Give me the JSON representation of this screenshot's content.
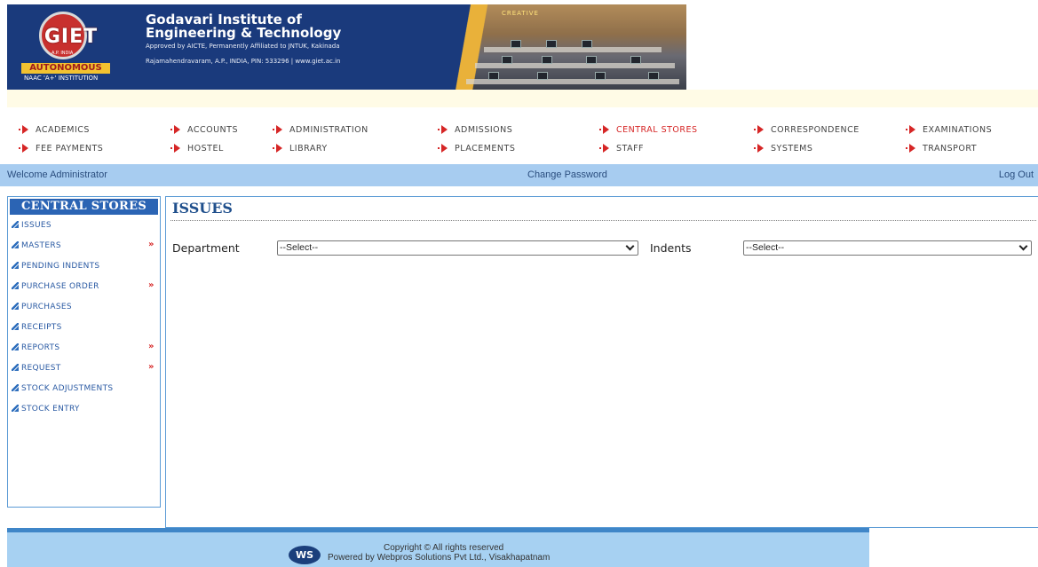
{
  "header": {
    "institute_name_line1": "Godavari Institute of",
    "institute_name_line2": "Engineering & Technology",
    "approval": "Approved by AICTE, Permanently Affiliated to JNTUK, Kakinada",
    "address": "Rajamahendravaram, A.P., INDIA, PIN: 533296 | www.giet.ac.in",
    "logo_letters": "GIET",
    "logo_sub": "A.P. INDIA",
    "logo_autonomous": "AUTONOMOUS",
    "logo_naac": "NAAC 'A+' INSTITUTION",
    "photo_label": "CREATIVE"
  },
  "nav": {
    "row1": [
      "ACADEMICS",
      "ACCOUNTS",
      "ADMINISTRATION",
      "ADMISSIONS",
      "CENTRAL STORES",
      "CORRESPONDENCE",
      "EXAMINATIONS"
    ],
    "row2": [
      "FEE PAYMENTS",
      "HOSTEL",
      "LIBRARY",
      "PLACEMENTS",
      "STAFF",
      "SYSTEMS",
      "TRANSPORT"
    ],
    "active": "CENTRAL STORES"
  },
  "welcome_bar": {
    "welcome": "Welcome Administrator",
    "change_password": "Change Password",
    "logout": "Log Out"
  },
  "sidebar": {
    "title": "CENTRAL STORES",
    "items": [
      {
        "label": "ISSUES",
        "has_submenu": false
      },
      {
        "label": "MASTERS",
        "has_submenu": true
      },
      {
        "label": "PENDING INDENTS",
        "has_submenu": false
      },
      {
        "label": "PURCHASE ORDER",
        "has_submenu": true
      },
      {
        "label": "PURCHASES",
        "has_submenu": false
      },
      {
        "label": "RECEIPTS",
        "has_submenu": false
      },
      {
        "label": "REPORTS",
        "has_submenu": true
      },
      {
        "label": "REQUEST",
        "has_submenu": true
      },
      {
        "label": "STOCK ADJUSTMENTS",
        "has_submenu": false
      },
      {
        "label": "STOCK ENTRY",
        "has_submenu": false
      }
    ],
    "submenu_marker": "»"
  },
  "main": {
    "title": "ISSUES",
    "department_label": "Department",
    "department_value": "--Select--",
    "indents_label": "Indents",
    "indents_value": "--Select--"
  },
  "footer": {
    "logo_text": "WS",
    "copyright": "Copyright © All rights reserved",
    "powered_by": "Powered by Webpros Solutions Pvt Ltd., Visakhapatnam"
  },
  "colors": {
    "accent_red": "#d62626",
    "nav_blue": "#2b64b4",
    "bar_blue": "#a7ccf0",
    "banner_navy": "#1a3a7c"
  }
}
